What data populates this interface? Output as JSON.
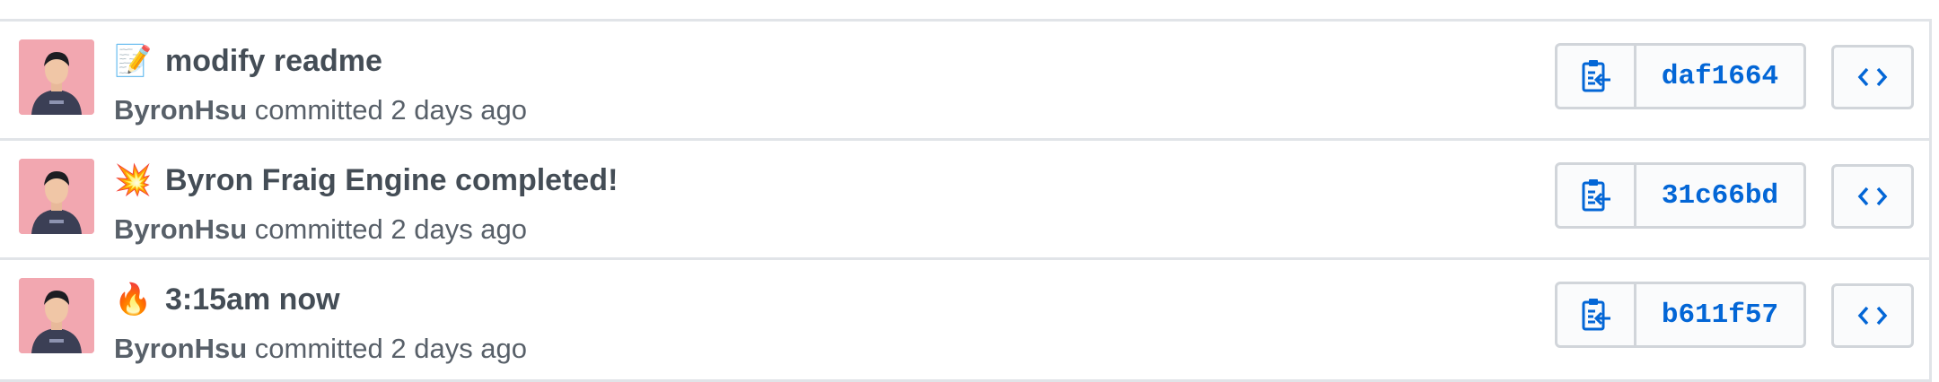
{
  "commits": [
    {
      "emoji": "📝",
      "emoji_icon": "memo-icon",
      "title": "modify readme",
      "author": "ByronHsu",
      "action": "committed 2 days ago",
      "sha": "daf1664"
    },
    {
      "emoji": "💥",
      "emoji_icon": "collision-icon",
      "title": "Byron Fraig Engine completed!",
      "author": "ByronHsu",
      "action": "committed 2 days ago",
      "sha": "31c66bd"
    },
    {
      "emoji": "🔥",
      "emoji_icon": "fire-icon",
      "title": "3:15am now",
      "author": "ByronHsu",
      "action": "committed 2 days ago",
      "sha": "b611f57"
    }
  ],
  "colors": {
    "link": "#0366d6",
    "border": "#d1d5da",
    "text_muted": "#586069",
    "avatar_bg": "#f2a7b0"
  }
}
